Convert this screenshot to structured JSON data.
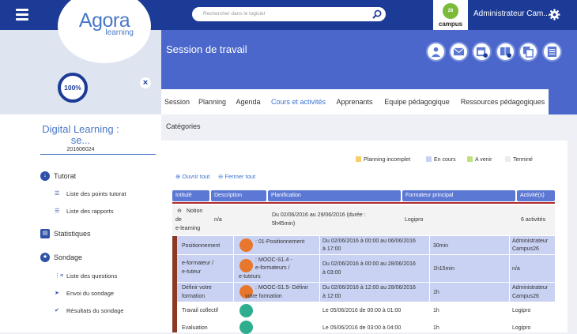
{
  "header": {
    "search_placeholder": "Rechercher dans le logiciel",
    "admin": "Administrateur Cam...",
    "campus_label": "campus",
    "campus_num": "26"
  },
  "logo": {
    "main": "Agora",
    "sub": "learning"
  },
  "progress": "100%",
  "page_title": "Session de travail",
  "tabs": [
    "Session",
    "Planning",
    "Agenda",
    "Cours et activités",
    "Apprenants",
    "Equipe pédagogique",
    "Ressources pédagogiques"
  ],
  "sidebar": {
    "course_title_1": "Digital Learning :",
    "course_title_2": "se...",
    "course_code": "201606024",
    "sections": [
      {
        "label": "Tutorat",
        "icon": "download-icon"
      },
      {
        "label": "Statistiques",
        "icon": "chart-icon"
      },
      {
        "label": "Sondage",
        "icon": "star-icon"
      }
    ],
    "tutorat_items": [
      "Liste des points tutorat",
      "Liste des rapports"
    ],
    "sondage_items": [
      "Liste des questions",
      "Envoi du sondage",
      "Résultats du sondage"
    ]
  },
  "categories": "Catégories",
  "legend": [
    {
      "label": "Planning incomplet",
      "color": "#f5cf6a"
    },
    {
      "label": "En cours",
      "color": "#c9d2f3"
    },
    {
      "label": "A venir",
      "color": "#bde27a"
    },
    {
      "label": "Terminé",
      "color": "#ececec"
    }
  ],
  "actions": {
    "open_all": "Ouvrir tout",
    "close_all": "Fermer tout"
  },
  "columns": [
    "Intitulé",
    "Description",
    "Planification",
    "Formateur principal",
    "Activité(s)"
  ],
  "module": {
    "title_1": "Notion",
    "title_2": "de",
    "title_3": "e-learning",
    "desc": "n/a",
    "plan_1": "Du 02/06/2016 au 29/06/2016 (durée :",
    "plan_2": "5h45min)",
    "trainer": "Logipro",
    "count": "6 activités"
  },
  "activities": [
    {
      "name_1": "Positionnement",
      "name_2": "",
      "desc_1": ": 01-Positionnement",
      "desc_2": "",
      "plan_1": "Du 02/06/2016 à 00:00 au 06/06/2016",
      "plan_2": "à 17:00",
      "duration": "30min",
      "trainer_1": "Administrateur",
      "trainer_2": "Campus26",
      "icon_color": "#e8772e",
      "status": "c"
    },
    {
      "name_1": "e-formateur /",
      "name_2": "e-tuteur",
      "desc_1": ": MOOC-S1.4 -",
      "desc_2": "e-formateurs /",
      "desc_3": "e-tuteurs",
      "plan_1": "Du 02/06/2016 à 00:00 au 28/06/2016",
      "plan_2": "à 03:00",
      "duration": "1h15min",
      "trainer_1": "n/a",
      "trainer_2": "",
      "icon_color": "#e8772e",
      "status": "c"
    },
    {
      "name_1": "Définir votre",
      "name_2": "formation",
      "desc_1": ": MOOC-S1.5- Définir",
      "desc_2": "votre formation",
      "plan_1": "Du 02/06/2016 à 12:00 au 28/06/2016",
      "plan_2": "à 12:00",
      "duration": "1h",
      "trainer_1": "Administrateur",
      "trainer_2": "Campus26",
      "icon_color": "#e8772e",
      "status": "c"
    },
    {
      "name_1": "Travail collectif",
      "name_2": "",
      "desc_1": "",
      "desc_2": "",
      "plan_1": "Le 05/06/2016 de 00:00 à 01:00",
      "plan_2": "",
      "duration": "1h",
      "trainer_1": "Logipro",
      "trainer_2": "",
      "icon_color": "#2eae8e",
      "status": "w"
    },
    {
      "name_1": "Evaluation",
      "name_2": "",
      "desc_1": "",
      "desc_2": "",
      "plan_1": "Le 05/06/2016 de 03:00 à 04:00",
      "plan_2": "",
      "duration": "1h",
      "trainer_1": "Logipro",
      "trainer_2": "",
      "icon_color": "#2eae8e",
      "status": "w"
    }
  ]
}
